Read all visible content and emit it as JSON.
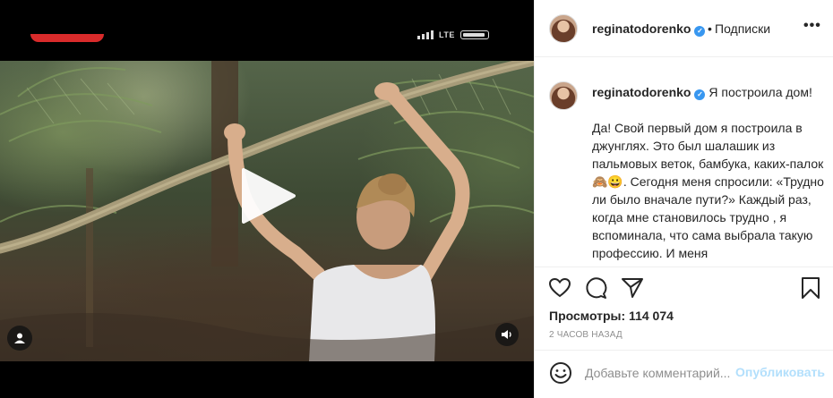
{
  "header": {
    "username": "reginatodorenko",
    "dot": "•",
    "follow_label": "Подписки",
    "more": "•••"
  },
  "caption": {
    "username": "reginatodorenko",
    "first": "Я построила дом!",
    "body": "Да! Свой первый дом я построила в джунглях. Это был шалашик из пальмовых веток, бамбука, каких-палок🙈😀. Сегодня меня спросили: «Трудно ли было вначале пути?» Каждый раз, когда мне становилось трудно , я вспоминала, что сама выбрала такую профессию. И меня"
  },
  "status_bar": {
    "network": "LTE"
  },
  "stats": {
    "views": "Просмотры: 114 074",
    "time_ago": "2 ЧАСОВ НАЗАД"
  },
  "comment_box": {
    "placeholder": "Добавьте комментарий...",
    "publish_label": "Опубликовать"
  },
  "icons": {
    "like": "heart-icon",
    "comment": "comment-icon",
    "share": "paper-plane-icon",
    "save": "bookmark-icon",
    "play": "play-icon",
    "sound": "speaker-icon",
    "emoji": "smiley-icon",
    "tagged": "user-icon"
  },
  "colors": {
    "verified": "#3897f0",
    "publish_disabled": "#b2dffc",
    "recording": "#d92b2b"
  }
}
